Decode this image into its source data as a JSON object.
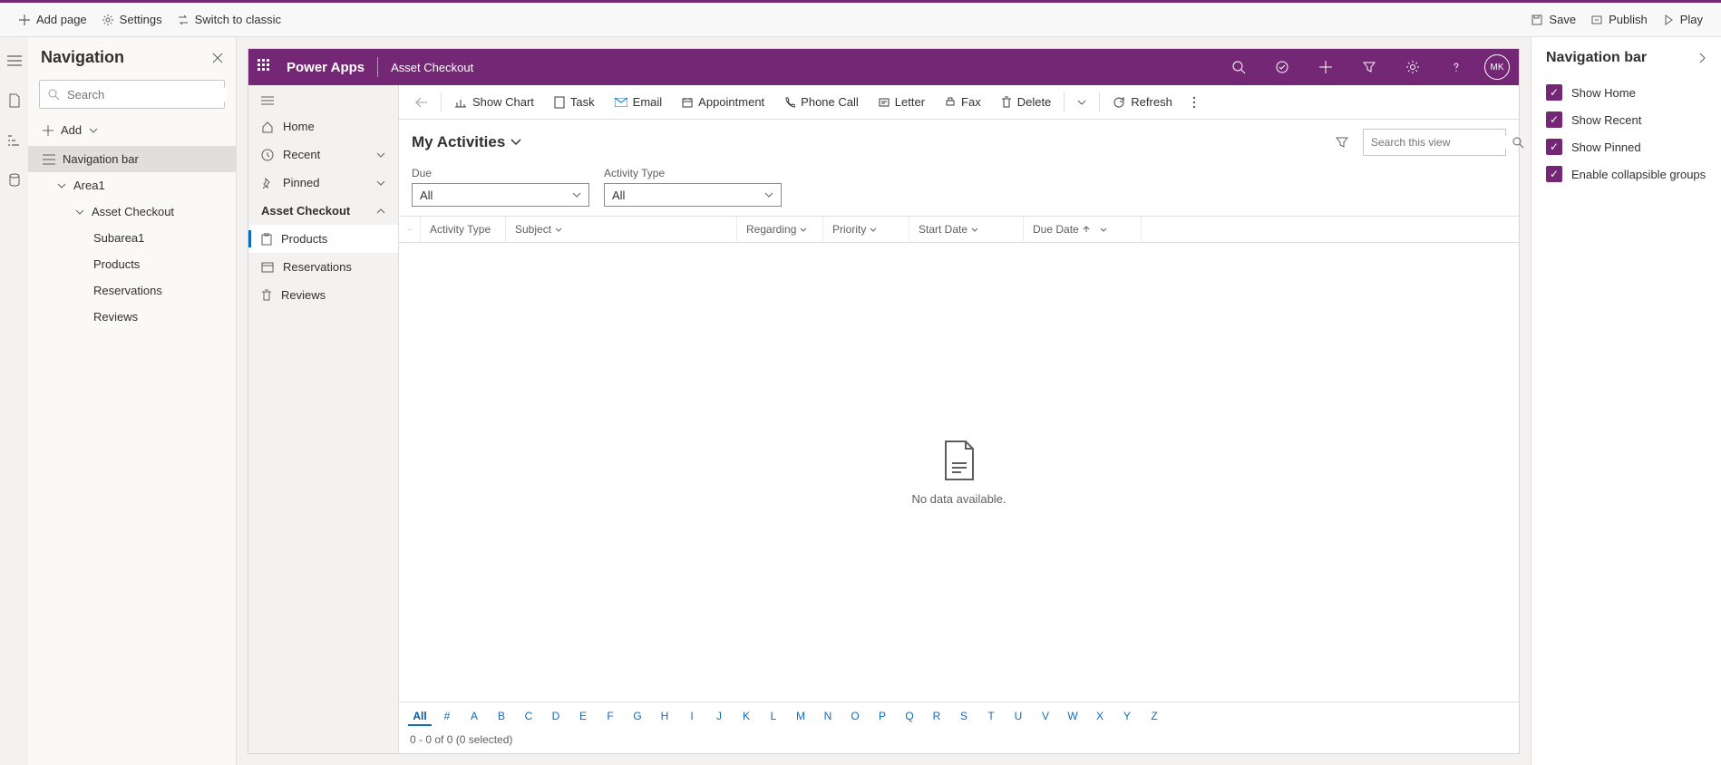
{
  "appToolbar": {
    "addPage": "Add page",
    "settings": "Settings",
    "switch": "Switch to classic",
    "save": "Save",
    "publish": "Publish",
    "play": "Play"
  },
  "leftPanel": {
    "title": "Navigation",
    "searchPlaceholder": "Search",
    "add": "Add",
    "tree": {
      "navbar": "Navigation bar",
      "area1": "Area1",
      "assetCheckout": "Asset Checkout",
      "subarea1": "Subarea1",
      "products": "Products",
      "reservations": "Reservations",
      "reviews": "Reviews"
    }
  },
  "paHeader": {
    "brand": "Power Apps",
    "app": "Asset Checkout",
    "avatar": "MK"
  },
  "paSide": {
    "home": "Home",
    "recent": "Recent",
    "pinned": "Pinned",
    "asset": "Asset Checkout",
    "products": "Products",
    "reservations": "Reservations",
    "reviews": "Reviews"
  },
  "cmd": {
    "showChart": "Show Chart",
    "task": "Task",
    "email": "Email",
    "appointment": "Appointment",
    "phone": "Phone Call",
    "letter": "Letter",
    "fax": "Fax",
    "delete": "Delete",
    "refresh": "Refresh"
  },
  "view": {
    "title": "My Activities",
    "searchPlaceholder": "Search this view"
  },
  "filters": {
    "dueLabel": "Due",
    "dueValue": "All",
    "typeLabel": "Activity Type",
    "typeValue": "All"
  },
  "columns": {
    "activityType": "Activity Type",
    "subject": "Subject",
    "regarding": "Regarding",
    "priority": "Priority",
    "startDate": "Start Date",
    "dueDate": "Due Date"
  },
  "empty": "No data available.",
  "index": [
    "All",
    "#",
    "A",
    "B",
    "C",
    "D",
    "E",
    "F",
    "G",
    "H",
    "I",
    "J",
    "K",
    "L",
    "M",
    "N",
    "O",
    "P",
    "Q",
    "R",
    "S",
    "T",
    "U",
    "V",
    "W",
    "X",
    "Y",
    "Z"
  ],
  "status": "0 - 0 of 0 (0 selected)",
  "rightPanel": {
    "title": "Navigation bar",
    "opts": {
      "home": "Show Home",
      "recent": "Show Recent",
      "pinned": "Show Pinned",
      "collapse": "Enable collapsible groups"
    }
  }
}
